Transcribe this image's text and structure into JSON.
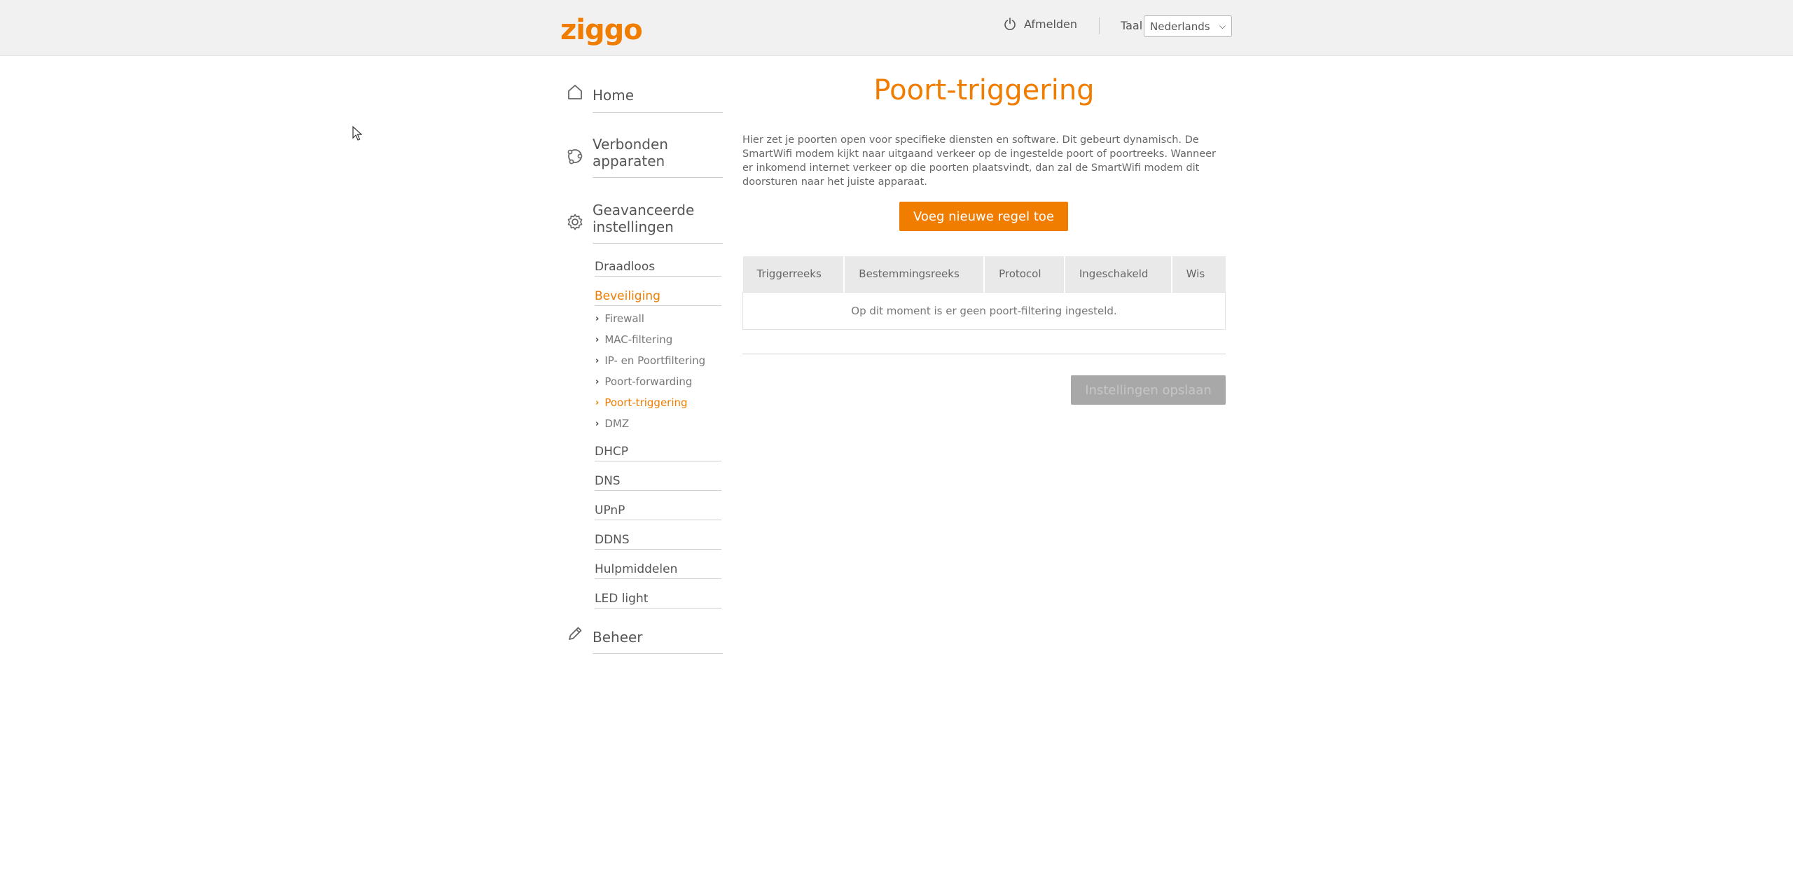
{
  "header": {
    "logo_text": "ziggo",
    "logout_label": "Afmelden",
    "language_label": "Taal",
    "language_value": "Nederlands"
  },
  "sidebar": {
    "home": "Home",
    "connected_devices": "Verbonden apparaten",
    "advanced_settings": "Geavanceerde instellingen",
    "advanced_items": [
      "Draadloos",
      "Beveiliging",
      "DHCP",
      "DNS",
      "UPnP",
      "DDNS",
      "Hulpmiddelen",
      "LED light"
    ],
    "security_items": [
      "Firewall",
      "MAC-filtering",
      "IP- en Poortfiltering",
      "Poort-forwarding",
      "Poort-triggering",
      "DMZ"
    ],
    "management": "Beheer"
  },
  "main": {
    "title": "Poort-triggering",
    "intro": "Hier zet je poorten open voor specifieke diensten en software. Dit gebeurt dynamisch. De SmartWifi modem kijkt naar uitgaand verkeer op de ingestelde poort of poortreeks. Wanneer er inkomend internet verkeer op die poorten plaatsvindt, dan zal de SmartWifi modem dit doorsturen naar het juiste apparaat.",
    "add_button": "Voeg nieuwe regel toe",
    "table_headers": [
      "Triggerreeks",
      "Bestemmingsreeks",
      "Protocol",
      "Ingeschakeld",
      "Wis"
    ],
    "empty_message": "Op dit moment is er geen poort-filtering ingesteld.",
    "save_button": "Instellingen opslaan"
  },
  "colors": {
    "accent": "#f07c00",
    "topbar": "#f1f1f1",
    "disabled_button": "#a8a8a8"
  }
}
